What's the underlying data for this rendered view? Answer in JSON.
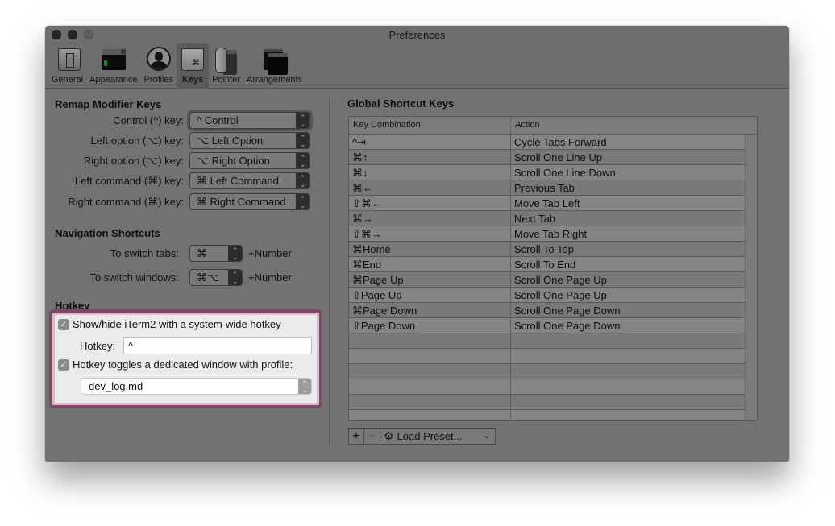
{
  "window": {
    "title": "Preferences",
    "traffic_lights": [
      "close",
      "minimize",
      "zoom"
    ]
  },
  "toolbar": {
    "items": [
      {
        "label": "General",
        "icon": "switch-icon",
        "selected": false
      },
      {
        "label": "Appearance",
        "icon": "terminal-window-icon",
        "selected": false
      },
      {
        "label": "Profiles",
        "icon": "user-silhouette-icon",
        "selected": false
      },
      {
        "label": "Keys",
        "icon": "command-key-icon",
        "selected": true
      },
      {
        "label": "Pointer",
        "icon": "mouse-icon",
        "selected": false
      },
      {
        "label": "Arrangements",
        "icon": "stacked-windows-icon",
        "selected": false
      }
    ]
  },
  "remap": {
    "title": "Remap Modifier Keys",
    "rows": [
      {
        "label": "Control (^) key:",
        "value": "^ Control"
      },
      {
        "label": "Left option (⌥) key:",
        "value": "⌥ Left Option"
      },
      {
        "label": "Right option (⌥) key:",
        "value": "⌥ Right Option"
      },
      {
        "label": "Left command (⌘) key:",
        "value": "⌘ Left Command"
      },
      {
        "label": "Right command (⌘) key:",
        "value": "⌘ Right Command"
      }
    ]
  },
  "navigation": {
    "title": "Navigation Shortcuts",
    "rows": [
      {
        "label": "To switch tabs:",
        "value": "⌘",
        "suffix": "+Number"
      },
      {
        "label": "To switch windows:",
        "value": "⌘⌥",
        "suffix": "+Number"
      }
    ]
  },
  "hotkey": {
    "title": "Hotkey",
    "show_hide_label": "Show/hide iTerm2 with a system-wide hotkey",
    "show_hide_checked": true,
    "hotkey_label": "Hotkey:",
    "hotkey_value": "^`",
    "dedicated_label": "Hotkey toggles a dedicated window with profile:",
    "dedicated_checked": true,
    "profile_value": "dev_log.md",
    "highlight_color": "#7b4a64"
  },
  "global_shortcuts": {
    "title": "Global Shortcut Keys",
    "columns": [
      "Key Combination",
      "Action"
    ],
    "rows": [
      {
        "key": "^⇥",
        "action": "Cycle Tabs Forward"
      },
      {
        "key": "⌘↑",
        "action": "Scroll One Line Up"
      },
      {
        "key": "⌘↓",
        "action": "Scroll One Line Down"
      },
      {
        "key": "⌘←",
        "action": "Previous Tab"
      },
      {
        "key": "⇧⌘←",
        "action": "Move Tab Left"
      },
      {
        "key": "⌘→",
        "action": "Next Tab"
      },
      {
        "key": "⇧⌘→",
        "action": "Move Tab Right"
      },
      {
        "key": "⌘Home",
        "action": "Scroll To Top"
      },
      {
        "key": "⌘End",
        "action": "Scroll To End"
      },
      {
        "key": "⌘Page Up",
        "action": "Scroll One Page Up"
      },
      {
        "key": "⇧Page Up",
        "action": "Scroll One Page Up"
      },
      {
        "key": "⌘Page Down",
        "action": "Scroll One Page Down"
      },
      {
        "key": "⇧Page Down",
        "action": "Scroll One Page Down"
      },
      {
        "key": "",
        "action": ""
      },
      {
        "key": "",
        "action": ""
      },
      {
        "key": "",
        "action": ""
      },
      {
        "key": "",
        "action": ""
      },
      {
        "key": "",
        "action": ""
      },
      {
        "key": "",
        "action": ""
      }
    ],
    "add_label": "+",
    "remove_label": "−",
    "preset_label": "Load Preset..."
  }
}
